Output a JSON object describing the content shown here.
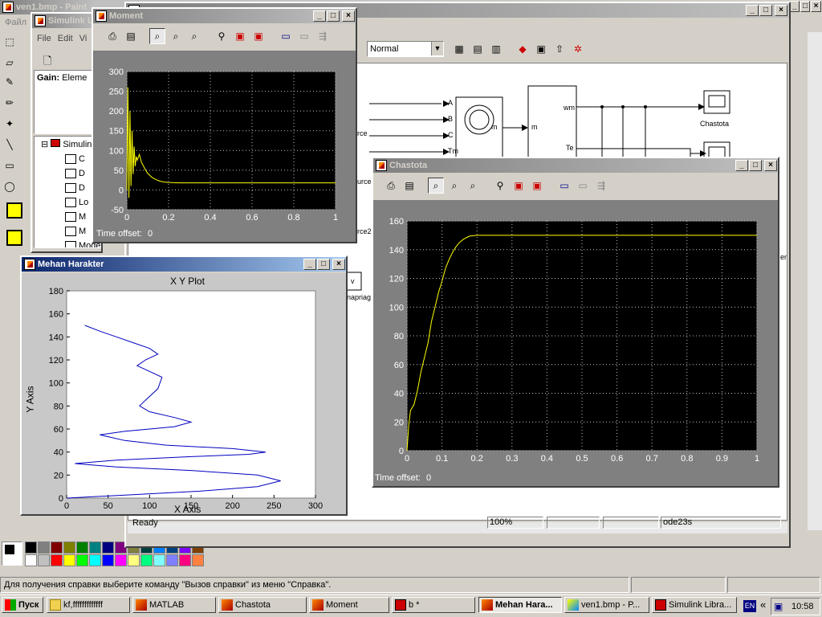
{
  "paint": {
    "title": "ven1.bmp - Paint",
    "menu_first": "Файл",
    "status": "Для получения справки выберите команду \"Вызов справки\" из меню \"Справка\"."
  },
  "simlib": {
    "title": "Simulink L",
    "menu": [
      "File",
      "Edit",
      "Vi"
    ],
    "gain_label": "Gain:",
    "gain_value": "Eleme",
    "tree_root": "Simulin",
    "tree_items": [
      "C",
      "D",
      "D",
      "Lo",
      "M",
      "M",
      "Model-Wo"
    ]
  },
  "model": {
    "mode": "Normal",
    "status_ready": "Ready",
    "zoom": "100%",
    "solver": "ode23s",
    "blocks": {
      "a": "A",
      "b": "B",
      "c": "C",
      "tm": "Tm",
      "m": "m",
      "m2": "m",
      "wm": "wm",
      "te": "Te",
      "v": "v",
      "chastota": "Chastota",
      "source1": "rce",
      "source2": "ource",
      "source3": "rce2",
      "napriag": "napriag",
      "er": "er"
    }
  },
  "moment": {
    "title": "Moment",
    "time_offset_label": "Time offset:",
    "time_offset": "0"
  },
  "chastota": {
    "title": "Chastota",
    "time_offset_label": "Time offset:",
    "time_offset": "0"
  },
  "mehan": {
    "title": "Mehan Harakter",
    "plot_title": "X Y Plot",
    "xlabel": "X Axis",
    "ylabel": "Y Axis"
  },
  "taskbar": {
    "start": "Пуск",
    "items": [
      "kf,fffffffffffff",
      "MATLAB",
      "Chastota",
      "Moment",
      "b *",
      "Mehan Hara...",
      "ven1.bmp - P...",
      "Simulink Libra..."
    ],
    "lang": "EN",
    "clock": "10:58"
  },
  "colors": {
    "title_active": "#0a246a",
    "title_inactive": "#808080",
    "trace_yellow": "#ffff00",
    "trace_blue": "#0000c0"
  },
  "chart_data": [
    {
      "name": "Moment",
      "type": "line",
      "x_ticks": [
        "0",
        "0.2",
        "0.4",
        "0.6",
        "0.8",
        "1"
      ],
      "y_ticks": [
        "300",
        "250",
        "200",
        "150",
        "100",
        "50",
        "0",
        "-50"
      ],
      "xlim": [
        0,
        1
      ],
      "ylim": [
        -50,
        300
      ],
      "grid": true,
      "series": [
        {
          "x": [
            0,
            0.005,
            0.01,
            0.015,
            0.02,
            0.025,
            0.03,
            0.035,
            0.04,
            0.045,
            0.05,
            0.06,
            0.07,
            0.08,
            0.09,
            0.1,
            0.12,
            0.14,
            0.16,
            0.18,
            0.2,
            0.25,
            0.3,
            0.4,
            0.6,
            0.8,
            1
          ],
          "y": [
            0,
            260,
            -20,
            200,
            10,
            150,
            40,
            110,
            60,
            85,
            75,
            90,
            70,
            60,
            50,
            42,
            32,
            26,
            22,
            20,
            19,
            18,
            18,
            18,
            18,
            18,
            18
          ]
        }
      ]
    },
    {
      "name": "Chastota",
      "type": "line",
      "x_ticks": [
        "0",
        "0.1",
        "0.2",
        "0.3",
        "0.4",
        "0.5",
        "0.6",
        "0.7",
        "0.8",
        "0.9",
        "1"
      ],
      "y_ticks": [
        "160",
        "140",
        "120",
        "100",
        "80",
        "60",
        "40",
        "20",
        "0"
      ],
      "xlim": [
        0,
        1
      ],
      "ylim": [
        0,
        160
      ],
      "grid": true,
      "series": [
        {
          "x": [
            0,
            0.005,
            0.01,
            0.02,
            0.03,
            0.04,
            0.05,
            0.06,
            0.07,
            0.08,
            0.09,
            0.1,
            0.11,
            0.12,
            0.13,
            0.14,
            0.15,
            0.16,
            0.17,
            0.18,
            0.2,
            0.22,
            0.25,
            0.3,
            0.5,
            1
          ],
          "y": [
            0,
            18,
            28,
            32,
            42,
            55,
            65,
            75,
            90,
            100,
            110,
            118,
            127,
            133,
            138,
            142,
            145,
            147,
            148.5,
            149.5,
            150,
            150,
            150,
            150,
            150,
            150
          ]
        }
      ]
    },
    {
      "name": "Mehan Harakter",
      "type": "line",
      "title": "X Y Plot",
      "xlabel": "X Axis",
      "ylabel": "Y Axis",
      "x_ticks": [
        "0",
        "50",
        "100",
        "150",
        "200",
        "250",
        "300"
      ],
      "y_ticks": [
        "0",
        "20",
        "40",
        "60",
        "80",
        "100",
        "120",
        "140",
        "160",
        "180"
      ],
      "xlim": [
        0,
        300
      ],
      "ylim": [
        0,
        180
      ],
      "grid": false,
      "series": [
        {
          "x": [
            0,
            80,
            160,
            230,
            258,
            230,
            150,
            60,
            10,
            60,
            150,
            220,
            240,
            200,
            120,
            70,
            40,
            70,
            130,
            150,
            130,
            100,
            88,
            95,
            110,
            115,
            100,
            85,
            95,
            110,
            100,
            80,
            60,
            40,
            22
          ],
          "y": [
            0,
            3,
            6,
            10,
            15,
            20,
            24,
            27,
            30,
            33,
            36,
            38,
            40,
            43,
            46,
            50,
            55,
            58,
            62,
            66,
            70,
            75,
            80,
            85,
            95,
            105,
            110,
            115,
            120,
            125,
            130,
            135,
            140,
            145,
            150
          ]
        }
      ]
    }
  ]
}
